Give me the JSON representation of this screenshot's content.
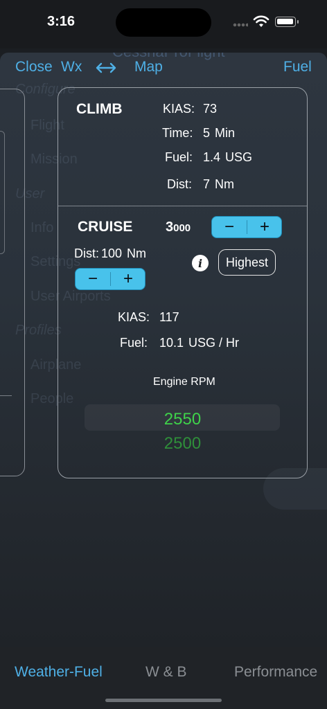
{
  "status": {
    "time": "3:16"
  },
  "nav": {
    "close": "Close",
    "wx": "Wx",
    "map": "Map",
    "fuel": "Fuel"
  },
  "background_ghost": {
    "title": "CessnaProFlight",
    "items": [
      "Configure",
      "Flight",
      "Mission",
      "User",
      "Info",
      "Settings",
      "User Airports",
      "Profiles",
      "Airplane",
      "People"
    ]
  },
  "climb": {
    "title": "CLIMB",
    "kias_label": "KIAS:",
    "kias_value": "73",
    "time_label": "Time:",
    "time_value": "5",
    "time_unit": "Min",
    "fuel_label": "Fuel:",
    "fuel_value": "1.4",
    "fuel_unit": "USG",
    "dist_label": "Dist:",
    "dist_value": "7",
    "dist_unit": "Nm"
  },
  "cruise": {
    "title": "CRUISE",
    "altitude_lead": "3",
    "altitude_rest": "000",
    "dist_label": "Dist:",
    "dist_value": "100",
    "dist_unit": "Nm",
    "minus": "−",
    "plus": "+",
    "highest_label": "Highest",
    "kias_label": "KIAS:",
    "kias_value": "117",
    "fuel_label": "Fuel:",
    "fuel_value": "10.1",
    "fuel_unit": "USG / Hr",
    "rpm_label": "Engine RPM",
    "rpm_selected": "2550",
    "rpm_next": "2500"
  },
  "colors": {
    "accent": "#4fb0e6",
    "stepper": "#48c2eb",
    "rpm_selected": "#3fd24a",
    "rpm_next": "#2f8f3a"
  },
  "tabs": [
    "Weather-Fuel",
    "W & B",
    "Performance"
  ],
  "active_tab": "Weather-Fuel"
}
